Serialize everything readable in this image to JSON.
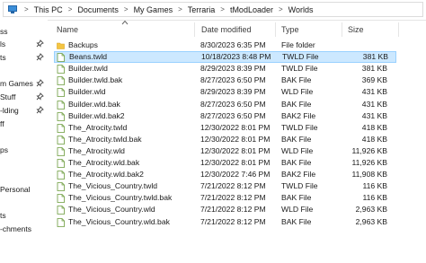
{
  "breadcrumb": [
    "This PC",
    "Documents",
    "My Games",
    "Terraria",
    "tModLoader",
    "Worlds"
  ],
  "breadcrumb_separator": ">",
  "sidebar": {
    "items": [
      {
        "label": "ss",
        "pinned": false
      },
      {
        "label": "ls",
        "pinned": true
      },
      {
        "label": "ts",
        "pinned": true
      },
      {
        "label": "",
        "pinned": false
      },
      {
        "label": "m Games",
        "pinned": true
      },
      {
        "label": "Stuff",
        "pinned": true
      },
      {
        "label": "-lding",
        "pinned": true
      },
      {
        "label": "ff",
        "pinned": false
      },
      {
        "label": "",
        "pinned": false
      },
      {
        "label": "ps",
        "pinned": false
      },
      {
        "label": "",
        "pinned": false
      },
      {
        "label": "",
        "pinned": false
      },
      {
        "label": "Personal",
        "pinned": false
      },
      {
        "label": "",
        "pinned": false
      },
      {
        "label": "ts",
        "pinned": false
      },
      {
        "label": "-chments",
        "pinned": false
      }
    ]
  },
  "columns": {
    "name": "Name",
    "date": "Date modified",
    "type": "Type",
    "size": "Size"
  },
  "sort_indicator": "^",
  "selected_row": 1,
  "files": [
    {
      "name": "Backups",
      "date": "8/30/2023 6:35 PM",
      "type": "File folder",
      "size": "",
      "icon": "folder-icon"
    },
    {
      "name": "Beans.twld",
      "date": "10/18/2023 8:48 PM",
      "type": "TWLD File",
      "size": "381 KB",
      "icon": "file-icon"
    },
    {
      "name": "Builder.twld",
      "date": "8/29/2023 8:39 PM",
      "type": "TWLD File",
      "size": "381 KB",
      "icon": "file-icon"
    },
    {
      "name": "Builder.twld.bak",
      "date": "8/27/2023 6:50 PM",
      "type": "BAK File",
      "size": "369 KB",
      "icon": "file-icon"
    },
    {
      "name": "Builder.wld",
      "date": "8/29/2023 8:39 PM",
      "type": "WLD File",
      "size": "431 KB",
      "icon": "file-icon"
    },
    {
      "name": "Builder.wld.bak",
      "date": "8/27/2023 6:50 PM",
      "type": "BAK File",
      "size": "431 KB",
      "icon": "file-icon"
    },
    {
      "name": "Builder.wld.bak2",
      "date": "8/27/2023 6:50 PM",
      "type": "BAK2 File",
      "size": "431 KB",
      "icon": "file-icon"
    },
    {
      "name": "The_Atrocity.twld",
      "date": "12/30/2022 8:01 PM",
      "type": "TWLD File",
      "size": "418 KB",
      "icon": "file-icon"
    },
    {
      "name": "The_Atrocity.twld.bak",
      "date": "12/30/2022 8:01 PM",
      "type": "BAK File",
      "size": "418 KB",
      "icon": "file-icon"
    },
    {
      "name": "The_Atrocity.wld",
      "date": "12/30/2022 8:01 PM",
      "type": "WLD File",
      "size": "11,926 KB",
      "icon": "file-icon"
    },
    {
      "name": "The_Atrocity.wld.bak",
      "date": "12/30/2022 8:01 PM",
      "type": "BAK File",
      "size": "11,926 KB",
      "icon": "file-icon"
    },
    {
      "name": "The_Atrocity.wld.bak2",
      "date": "12/30/2022 7:46 PM",
      "type": "BAK2 File",
      "size": "11,908 KB",
      "icon": "file-icon"
    },
    {
      "name": "The_Vicious_Country.twld",
      "date": "7/21/2022 8:12 PM",
      "type": "TWLD File",
      "size": "116 KB",
      "icon": "file-icon"
    },
    {
      "name": "The_Vicious_Country.twld.bak",
      "date": "7/21/2022 8:12 PM",
      "type": "BAK File",
      "size": "116 KB",
      "icon": "file-icon"
    },
    {
      "name": "The_Vicious_Country.wld",
      "date": "7/21/2022 8:12 PM",
      "type": "WLD File",
      "size": "2,963 KB",
      "icon": "file-icon"
    },
    {
      "name": "The_Vicious_Country.wld.bak",
      "date": "7/21/2022 8:12 PM",
      "type": "BAK File",
      "size": "2,963 KB",
      "icon": "file-icon"
    }
  ],
  "colors": {
    "selection_fill": "#cce8ff",
    "selection_border": "#99d1ff",
    "folder": "#f4c542",
    "file_outline": "#6a9a3a",
    "pin": "#444444"
  }
}
